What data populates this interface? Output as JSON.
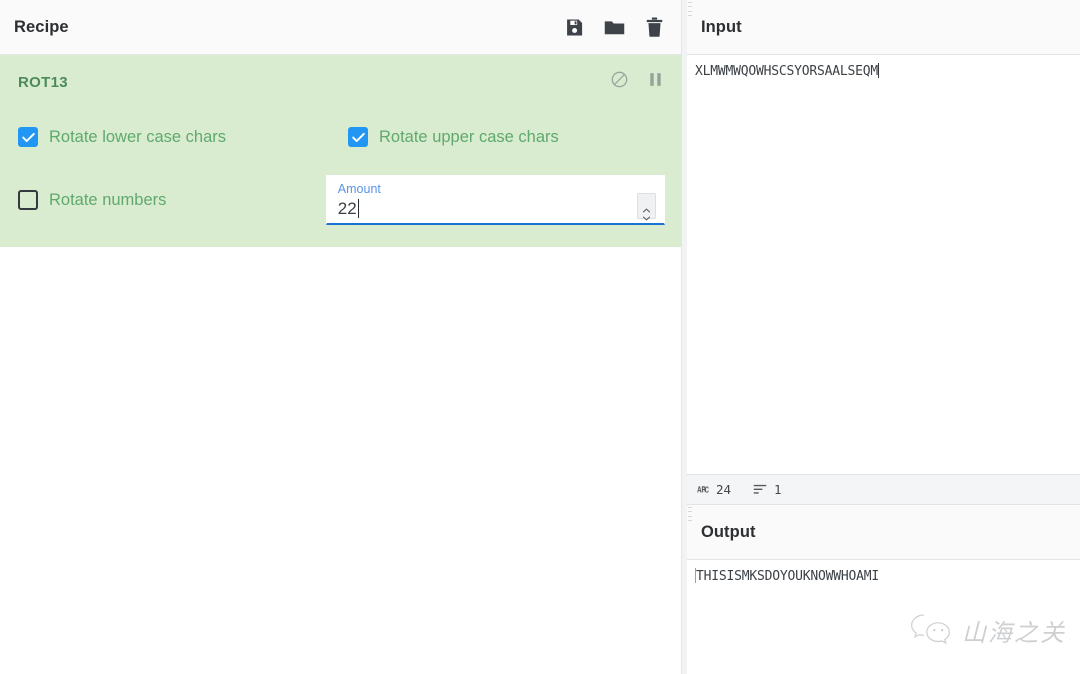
{
  "recipe": {
    "title": "Recipe",
    "toolbar": [
      {
        "name": "save-recipe-button",
        "icon": "save-icon",
        "label": "Save recipe"
      },
      {
        "name": "load-recipe-button",
        "icon": "folder-icon",
        "label": "Load recipe"
      },
      {
        "name": "clear-recipe-button",
        "icon": "trash-icon",
        "label": "Clear recipe"
      }
    ],
    "operation": {
      "name": "ROT13",
      "controls": [
        {
          "name": "disable-operation-button",
          "icon": "circle-slash-icon",
          "label": "Disable operation"
        },
        {
          "name": "breakpoint-button",
          "icon": "pause-icon",
          "label": "Set breakpoint"
        }
      ],
      "args": {
        "rotate_lower": {
          "label": "Rotate lower case chars",
          "checked": true
        },
        "rotate_upper": {
          "label": "Rotate upper case chars",
          "checked": true
        },
        "rotate_numbers": {
          "label": "Rotate numbers",
          "checked": false
        },
        "amount": {
          "label": "Amount",
          "value": "22"
        }
      }
    }
  },
  "input": {
    "title": "Input",
    "text": "XLMWMWQOWHSCSYORSAALSEQM",
    "status": {
      "length_icon": "abc-icon",
      "length": "24",
      "lines_icon": "lines-icon",
      "lines": "1"
    }
  },
  "output": {
    "title": "Output",
    "text": "THISISMKSDOYOUKNOWWHOAMI"
  },
  "watermark": {
    "icon": "wechat-icon",
    "text": "山海之关"
  },
  "colors": {
    "accent_blue": "#2196f3",
    "operation_green_bg": "#d9ecd0",
    "operation_green_text": "#4b8b5a",
    "arg_label_green": "#5fa96e",
    "field_underline": "#1874d2"
  }
}
